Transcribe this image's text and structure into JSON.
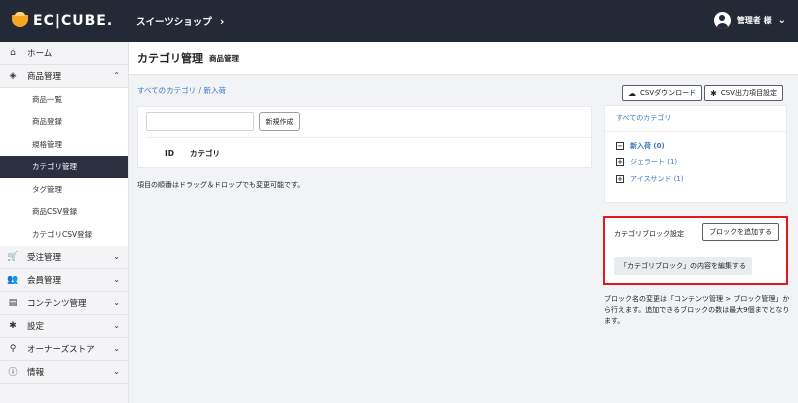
{
  "header": {
    "logo_text": "EC|CUBE.",
    "shop_name": "スイーツショップ",
    "shop_chevron": "›",
    "user_name": "管理者 様",
    "user_chevron": "⌄"
  },
  "sidebar": {
    "items": [
      {
        "icon": "⌂",
        "icon_name": "home-icon",
        "label": "ホーム",
        "arrow": ""
      },
      {
        "icon": "◈",
        "icon_name": "product-icon",
        "label": "商品管理",
        "arrow": "⌃"
      },
      {
        "icon": "🛒",
        "icon_name": "cart-icon",
        "label": "受注管理",
        "arrow": "⌄"
      },
      {
        "icon": "👥",
        "icon_name": "users-icon",
        "label": "会員管理",
        "arrow": "⌄"
      },
      {
        "icon": "▤",
        "icon_name": "document-icon",
        "label": "コンテンツ管理",
        "arrow": "⌄"
      },
      {
        "icon": "✱",
        "icon_name": "gear-icon",
        "label": "設定",
        "arrow": "⌄"
      },
      {
        "icon": "⚲",
        "icon_name": "plug-icon",
        "label": "オーナーズストア",
        "arrow": "⌄"
      },
      {
        "icon": "ⓘ",
        "icon_name": "info-icon",
        "label": "情報",
        "arrow": "⌄"
      }
    ],
    "subitems": [
      {
        "label": "商品一覧"
      },
      {
        "label": "商品登録"
      },
      {
        "label": "規格管理"
      },
      {
        "label": "カテゴリ管理"
      },
      {
        "label": "タグ管理"
      },
      {
        "label": "商品CSV登録"
      },
      {
        "label": "カテゴリCSV登録"
      }
    ]
  },
  "page": {
    "title": "カテゴリ管理",
    "subtitle": "商品管理",
    "breadcrumb": "すべてのカテゴリ / 新入荷",
    "new_button": "新規作成",
    "col_id": "ID",
    "col_category": "カテゴリ",
    "note": "項目の順番はドラッグ＆ドロップでも変更可能です。"
  },
  "right": {
    "csv_download": "CSVダウンロード",
    "csv_settings": "CSV出力項目設定",
    "tree_all": "すべてのカテゴリ",
    "tree_items": [
      {
        "box": "−",
        "label": "新入荷 (0)"
      },
      {
        "box": "+",
        "label": "ジェラート (1)"
      },
      {
        "box": "+",
        "label": "アイスサンド (1)"
      }
    ],
    "block_title": "カテゴリブロック設定",
    "add_block": "ブロックを追加する",
    "edit_block": "「カテゴリブロック」の内容を編集する",
    "block_note": "ブロック名の変更は「コンテンツ管理 > ブロック管理」から行えます。追加できるブロックの数は最大9個までとなります。"
  },
  "colors": {
    "topbar": "#242a35",
    "active_sub": "#2a3040",
    "link": "#3a78c2",
    "highlight": "#e0191c"
  }
}
